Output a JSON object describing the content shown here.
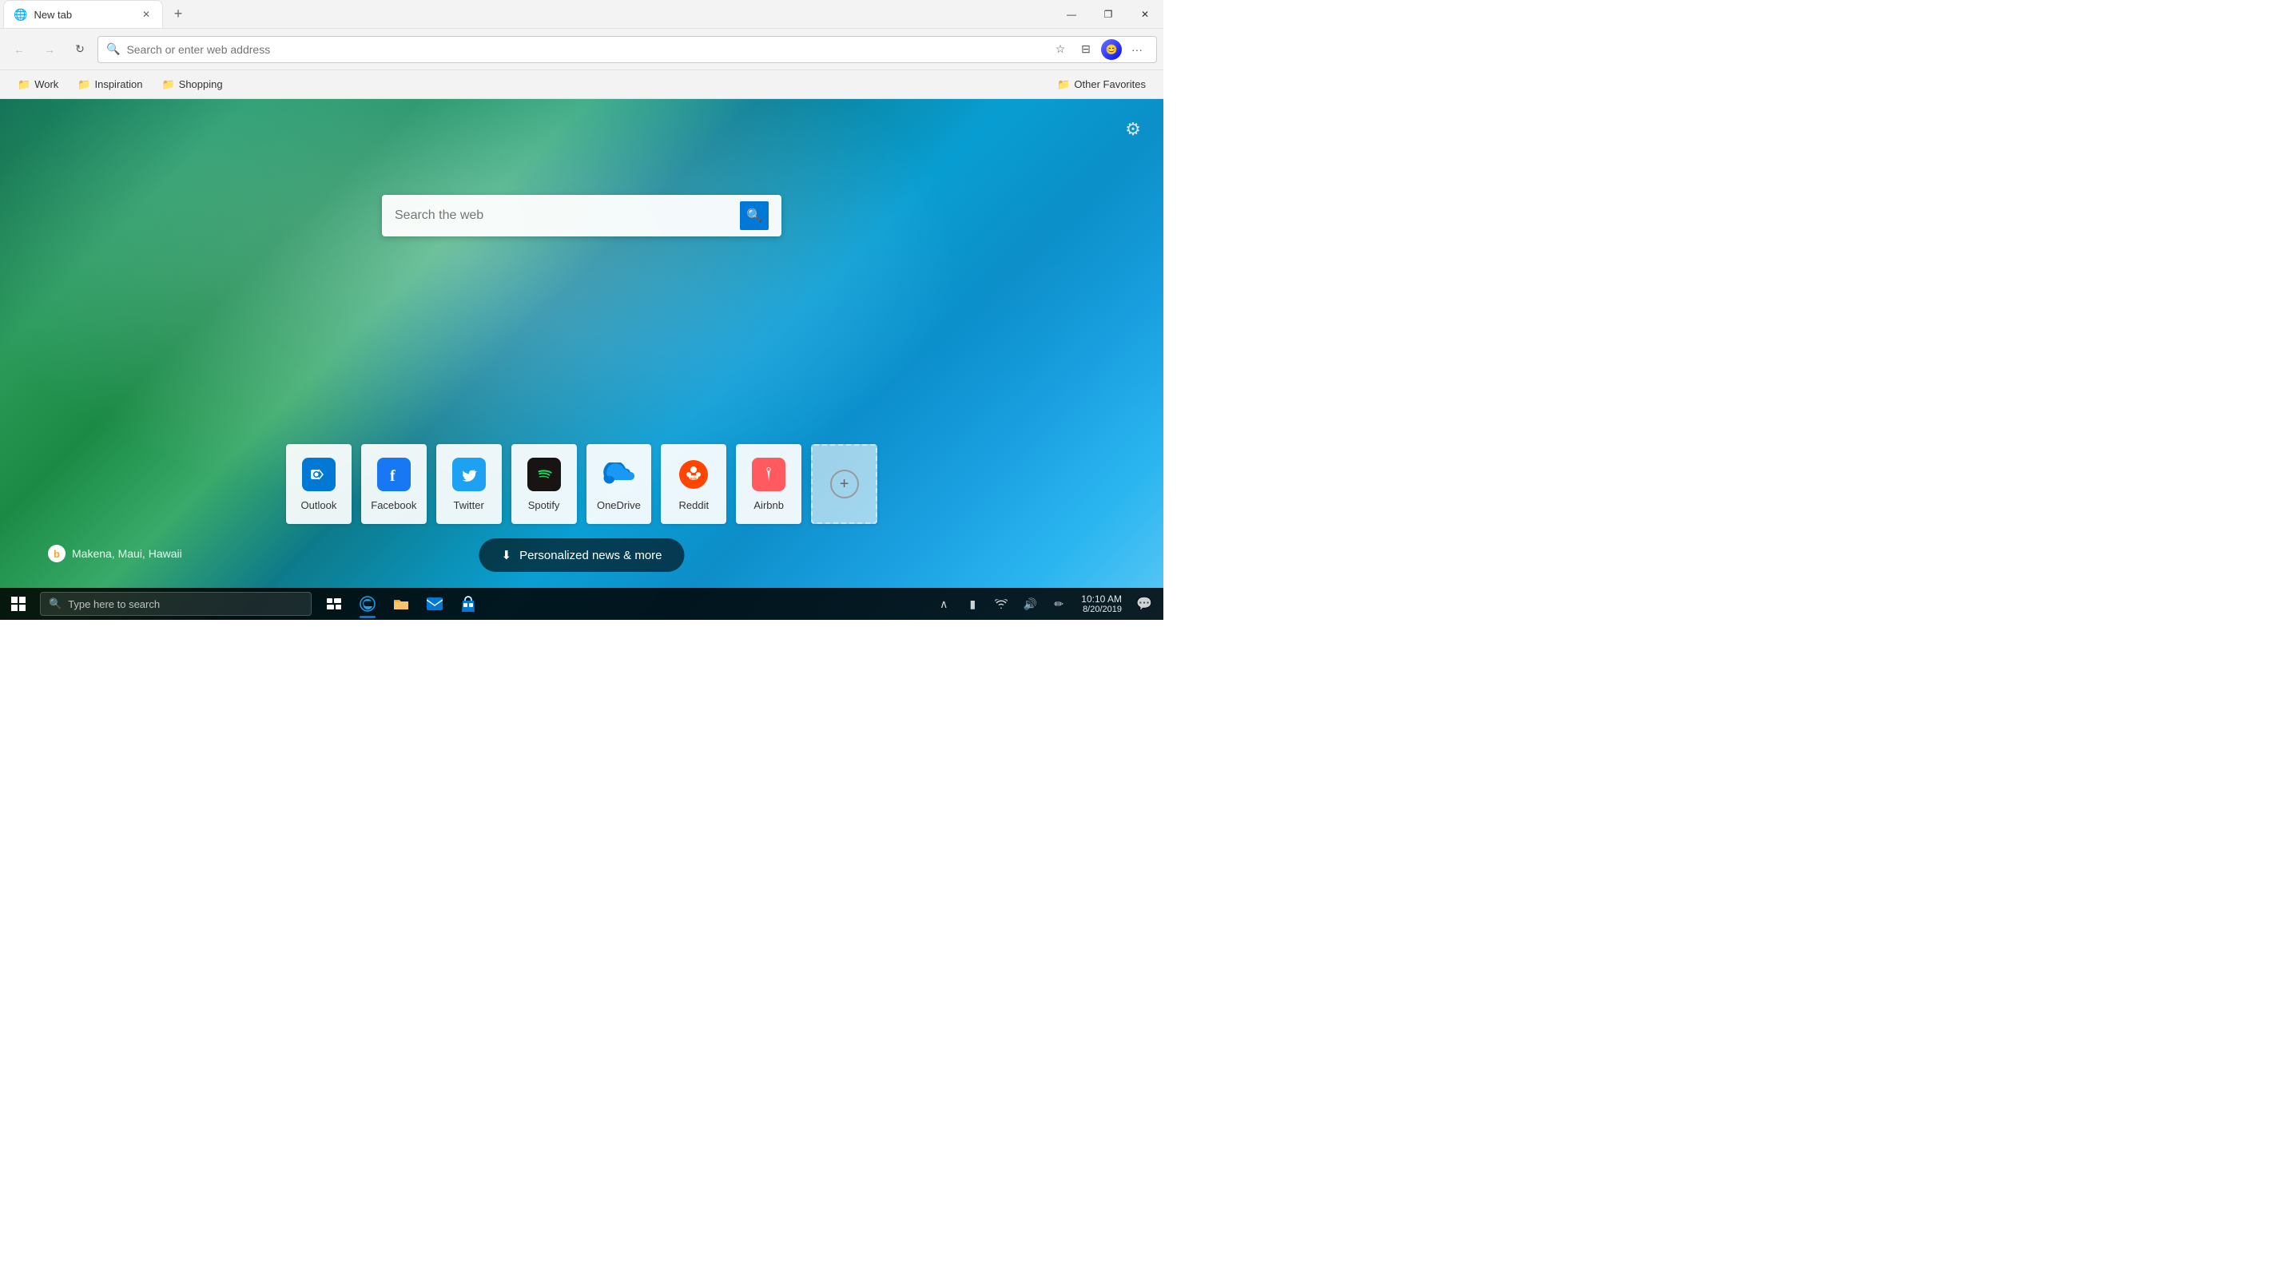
{
  "titlebar": {
    "tab_label": "New tab",
    "new_tab_tooltip": "New tab",
    "minimize": "—",
    "maximize": "❐",
    "close": "✕"
  },
  "navbar": {
    "back": "←",
    "forward": "→",
    "refresh": "↻",
    "address_placeholder": "Search or enter web address"
  },
  "bookmarks": {
    "items": [
      {
        "label": "Work",
        "icon": "📁"
      },
      {
        "label": "Inspiration",
        "icon": "📁"
      },
      {
        "label": "Shopping",
        "icon": "📁"
      }
    ],
    "other_favorites": "Other Favorites"
  },
  "new_tab": {
    "search_placeholder": "Search the web",
    "search_icon": "🔍",
    "settings_icon": "⚙",
    "location": "Makena, Maui, Hawaii"
  },
  "quick_links": [
    {
      "label": "Outlook",
      "icon_type": "outlook",
      "icon_char": "O",
      "url": "#"
    },
    {
      "label": "Facebook",
      "icon_type": "facebook",
      "icon_char": "f",
      "url": "#"
    },
    {
      "label": "Twitter",
      "icon_type": "twitter",
      "icon_char": "🐦",
      "url": "#"
    },
    {
      "label": "Spotify",
      "icon_type": "spotify",
      "icon_char": "♫",
      "url": "#"
    },
    {
      "label": "OneDrive",
      "icon_type": "onedrive",
      "icon_char": "☁",
      "url": "#"
    },
    {
      "label": "Reddit",
      "icon_type": "reddit",
      "icon_char": "R",
      "url": "#"
    },
    {
      "label": "Airbnb",
      "icon_type": "airbnb",
      "icon_char": "⬧",
      "url": "#"
    }
  ],
  "news_btn": {
    "label": "Personalized news & more",
    "icon": "⬇"
  },
  "taskbar": {
    "start_icon": "⊞",
    "search_placeholder": "Type here to search",
    "clock_time": "10:10 AM",
    "clock_date": "8/20/2019",
    "taskbar_icons": [
      {
        "name": "task-view",
        "icon": "⊡"
      },
      {
        "name": "edge",
        "icon": "e"
      },
      {
        "name": "file-explorer",
        "icon": "📁"
      },
      {
        "name": "mail",
        "icon": "✉"
      },
      {
        "name": "store",
        "icon": "🛍"
      }
    ]
  }
}
